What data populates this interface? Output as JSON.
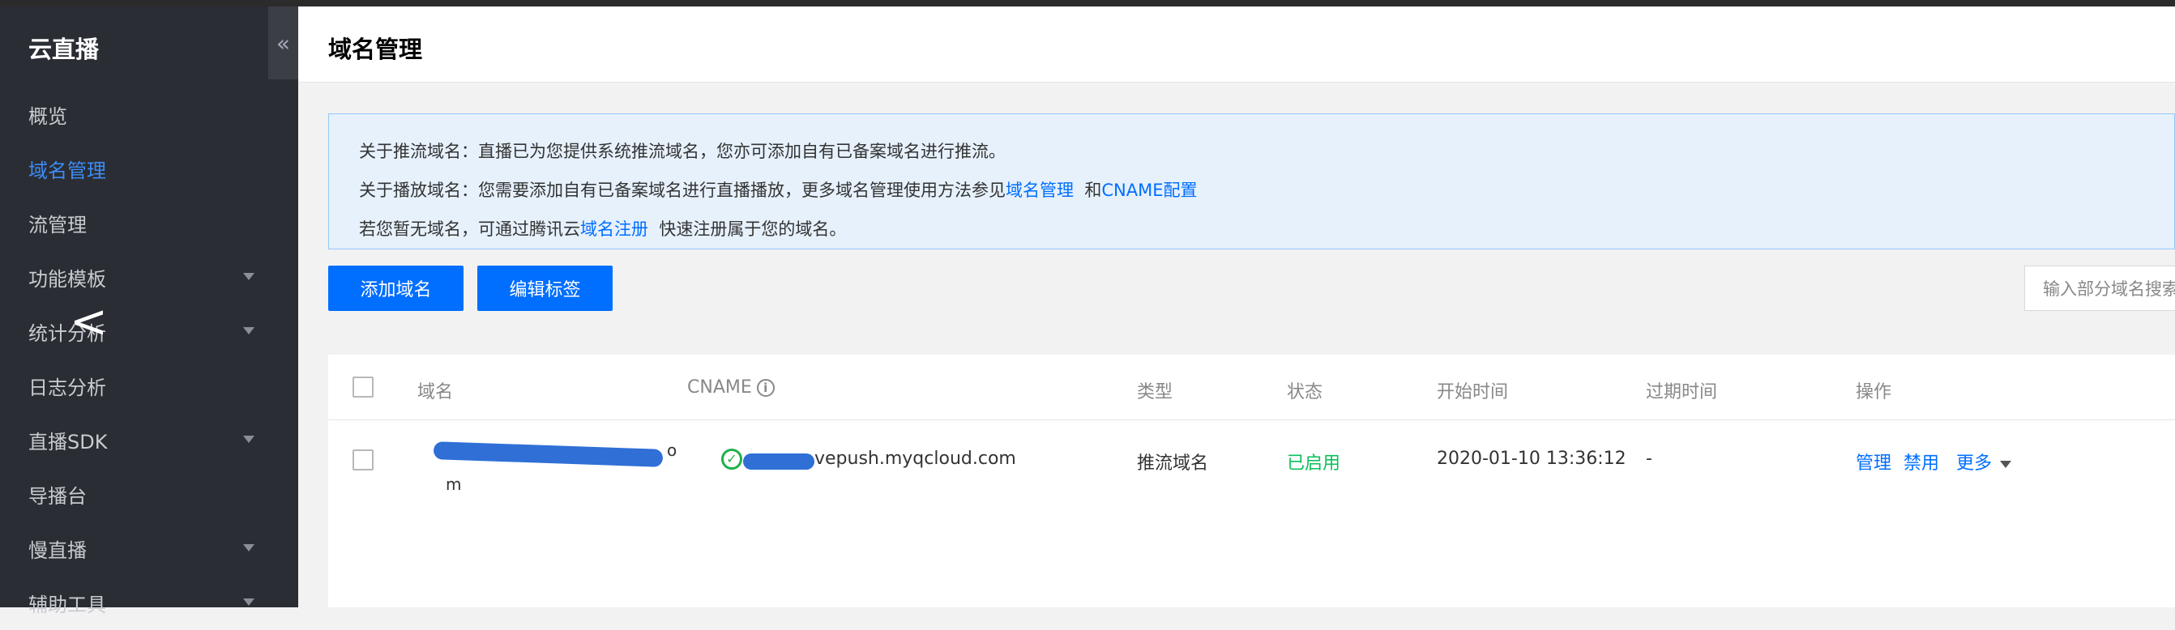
{
  "sidebar": {
    "title": "云直播",
    "collapse_glyph": "«",
    "items": [
      {
        "label": "概览",
        "active": false,
        "expandable": false
      },
      {
        "label": "域名管理",
        "active": true,
        "expandable": false
      },
      {
        "label": "流管理",
        "active": false,
        "expandable": false
      },
      {
        "label": "功能模板",
        "active": false,
        "expandable": true
      },
      {
        "label": "统计分析",
        "active": false,
        "expandable": true
      },
      {
        "label": "日志分析",
        "active": false,
        "expandable": false
      },
      {
        "label": "直播SDK",
        "active": false,
        "expandable": true
      },
      {
        "label": "导播台",
        "active": false,
        "expandable": false
      },
      {
        "label": "慢直播",
        "active": false,
        "expandable": true
      },
      {
        "label": "辅助工具",
        "active": false,
        "expandable": true
      }
    ],
    "overlay_glyph": "<"
  },
  "header": {
    "title": "域名管理"
  },
  "notice": {
    "line1": "关于推流域名：直播已为您提供系统推流域名，您亦可添加自有已备案域名进行推流。",
    "line2_prefix": "关于播放域名：您需要添加自有已备案域名进行直播播放，更多域名管理使用方法参见",
    "line2_link1": "域名管理",
    "line2_mid": "  和",
    "line2_link2": "CNAME配置",
    "line3_prefix": "若您暂无域名，可通过腾讯云",
    "line3_link": "域名注册",
    "line3_suffix": "  快速注册属于您的域名。"
  },
  "toolbar": {
    "add_domain": "添加域名",
    "edit_tags": "编辑标签",
    "search_placeholder": "输入部分域名搜索"
  },
  "table": {
    "columns": {
      "domain": "域名",
      "cname": "CNAME",
      "type": "类型",
      "status": "状态",
      "start_time": "开始时间",
      "expire_time": "过期时间",
      "actions": "操作"
    },
    "rows": [
      {
        "domain_visible_start": "",
        "domain_tail": "o",
        "domain_line2": "m",
        "cname_suffix": "vepush.myqcloud.com",
        "type": "推流域名",
        "status": "已启用",
        "start_time": "2020-01-10 13:36:12",
        "expire_time": "-",
        "actions": {
          "manage": "管理",
          "disable": "禁用",
          "more": "更多"
        }
      }
    ]
  },
  "colors": {
    "sidebar_bg": "#2a2d33",
    "active": "#3d8bf5",
    "primary": "#006eff",
    "status_enabled": "#0abf5b",
    "notice_bg": "#e6f1fc"
  }
}
